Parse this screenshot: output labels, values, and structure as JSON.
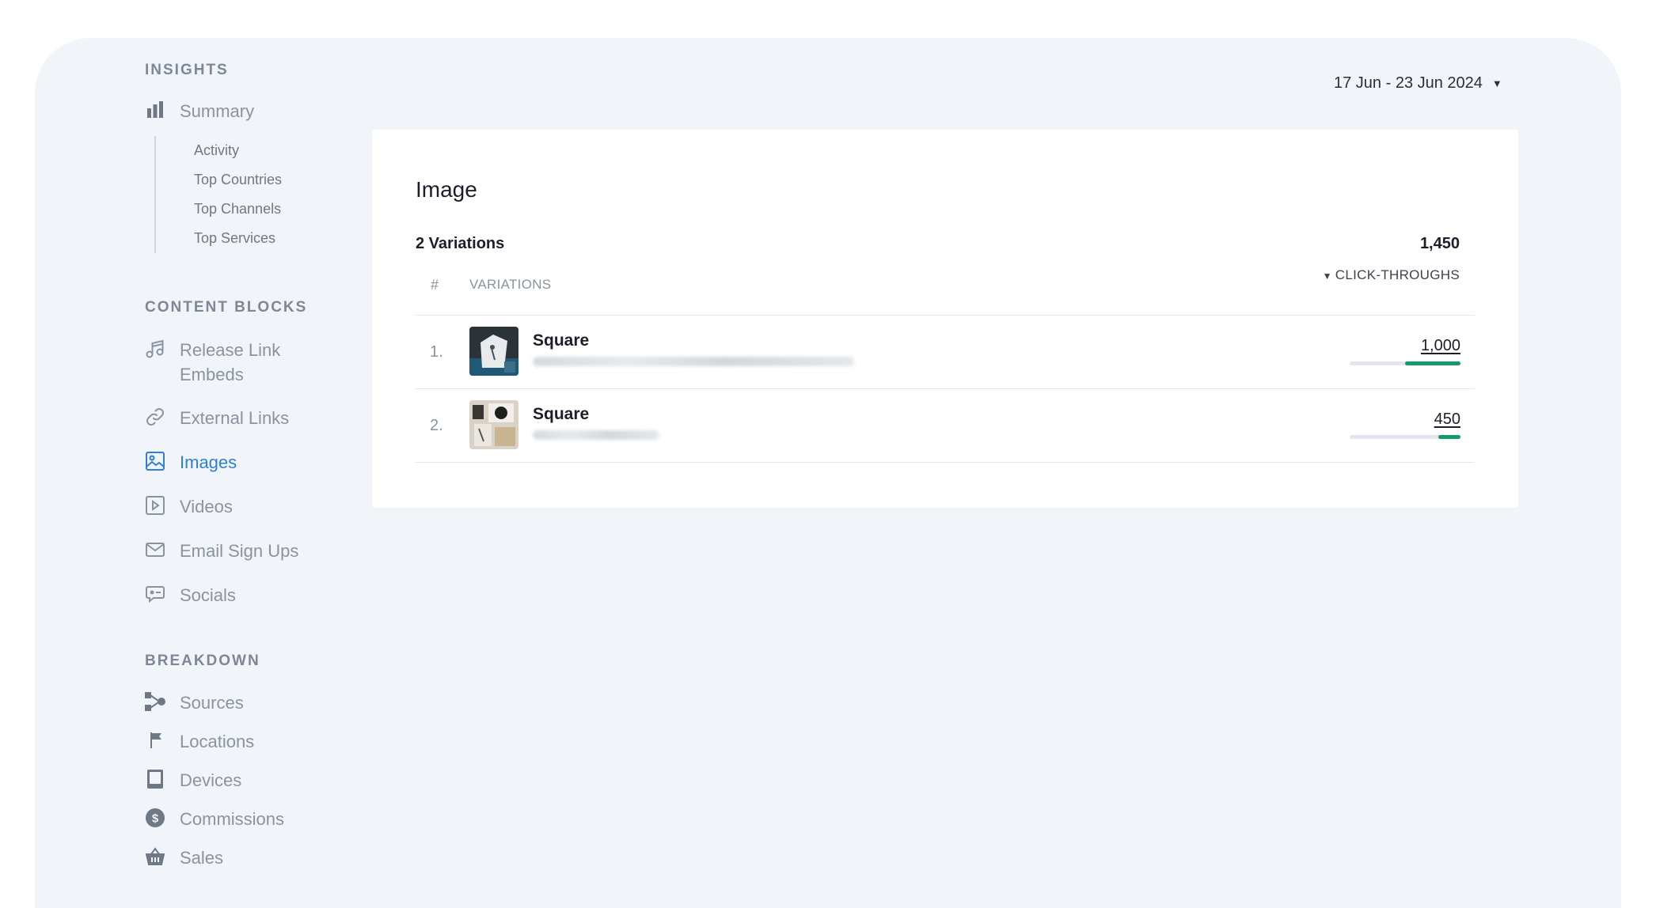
{
  "date_range": {
    "label": "17 Jun - 23 Jun 2024"
  },
  "sidebar": {
    "insights": {
      "title": "INSIGHTS",
      "summary": "Summary",
      "sub_items": [
        "Activity",
        "Top Countries",
        "Top Channels",
        "Top Services"
      ]
    },
    "content_blocks": {
      "title": "CONTENT BLOCKS",
      "items": [
        {
          "label": "Release Link\nEmbeds",
          "icon": "music-note-icon"
        },
        {
          "label": "External Links",
          "icon": "link-icon"
        },
        {
          "label": "Images",
          "icon": "image-icon",
          "active": true
        },
        {
          "label": "Videos",
          "icon": "play-icon"
        },
        {
          "label": "Email Sign Ups",
          "icon": "mail-icon"
        },
        {
          "label": "Socials",
          "icon": "chat-icon"
        }
      ]
    },
    "breakdown": {
      "title": "BREAKDOWN",
      "items": [
        {
          "label": "Sources",
          "icon": "flow-icon"
        },
        {
          "label": "Locations",
          "icon": "flag-icon"
        },
        {
          "label": "Devices",
          "icon": "tablet-icon"
        },
        {
          "label": "Commissions",
          "icon": "dollar-icon"
        },
        {
          "label": "Sales",
          "icon": "basket-icon"
        }
      ]
    }
  },
  "card": {
    "title": "Image",
    "variations_count": "2 Variations",
    "total": "1,450",
    "columns": {
      "hash": "#",
      "variations": "VARIATIONS",
      "clicks": "CLICK-THROUGHS"
    },
    "rows": [
      {
        "num": "1.",
        "title": "Square",
        "value": "1,000",
        "share": 0.5
      },
      {
        "num": "2.",
        "title": "Square",
        "value": "450",
        "share": 0.2
      }
    ]
  },
  "colors": {
    "accent": "#2f7fd6",
    "bar": "#159a6e",
    "background": "#f1f4f9"
  }
}
